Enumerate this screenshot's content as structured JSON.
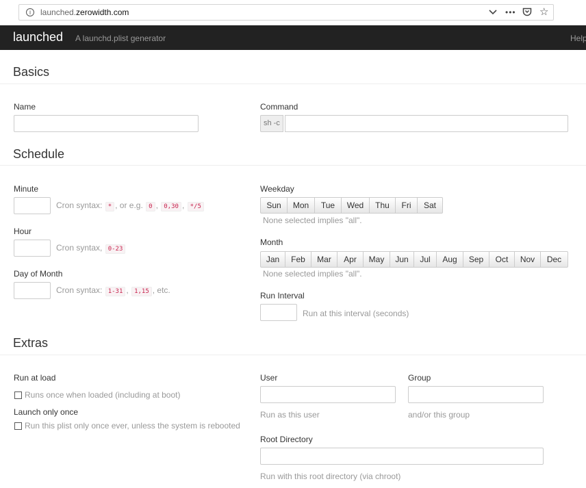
{
  "browser": {
    "url_prefix": "launched.",
    "url_domain": "zerowidth.com",
    "info_icon": "info-icon",
    "icons": [
      "chevron-down-icon",
      "more-icon",
      "pocket-icon",
      "star-icon"
    ]
  },
  "navbar": {
    "brand": "launched",
    "tagline": "A launchd.plist generator",
    "help": "Help"
  },
  "basics": {
    "heading": "Basics",
    "name_label": "Name",
    "command_label": "Command",
    "command_prefix": "sh -c"
  },
  "schedule": {
    "heading": "Schedule",
    "minute_label": "Minute",
    "minute_help_prefix": "Cron syntax:",
    "minute_help_mid": ", or e.g.",
    "minute_codes": [
      "*",
      "0",
      "0,30",
      "*/5"
    ],
    "hour_label": "Hour",
    "hour_help_prefix": "Cron syntax,",
    "hour_code": "0-23",
    "dom_label": "Day of Month",
    "dom_help_prefix": "Cron syntax:",
    "dom_codes": [
      "1-31",
      "1,15"
    ],
    "dom_help_suffix": ", etc.",
    "weekday_label": "Weekday",
    "weekdays": [
      "Sun",
      "Mon",
      "Tue",
      "Wed",
      "Thu",
      "Fri",
      "Sat"
    ],
    "weekday_help": "None selected implies \"all\".",
    "month_label": "Month",
    "months": [
      "Jan",
      "Feb",
      "Mar",
      "Apr",
      "May",
      "Jun",
      "Jul",
      "Aug",
      "Sep",
      "Oct",
      "Nov",
      "Dec"
    ],
    "month_help": "None selected implies \"all\".",
    "interval_label": "Run Interval",
    "interval_help": "Run at this interval (seconds)"
  },
  "extras": {
    "heading": "Extras",
    "run_at_load_label": "Run at load",
    "run_at_load_checkbox": "Runs once when loaded (including at boot)",
    "launch_once_label": "Launch only once",
    "launch_once_checkbox": "Run this plist only once ever, unless the system is rebooted",
    "user_label": "User",
    "user_help": "Run as this user",
    "group_label": "Group",
    "group_help": "and/or this group",
    "root_label": "Root Directory",
    "root_help": "Run with this root directory (via chroot)"
  }
}
